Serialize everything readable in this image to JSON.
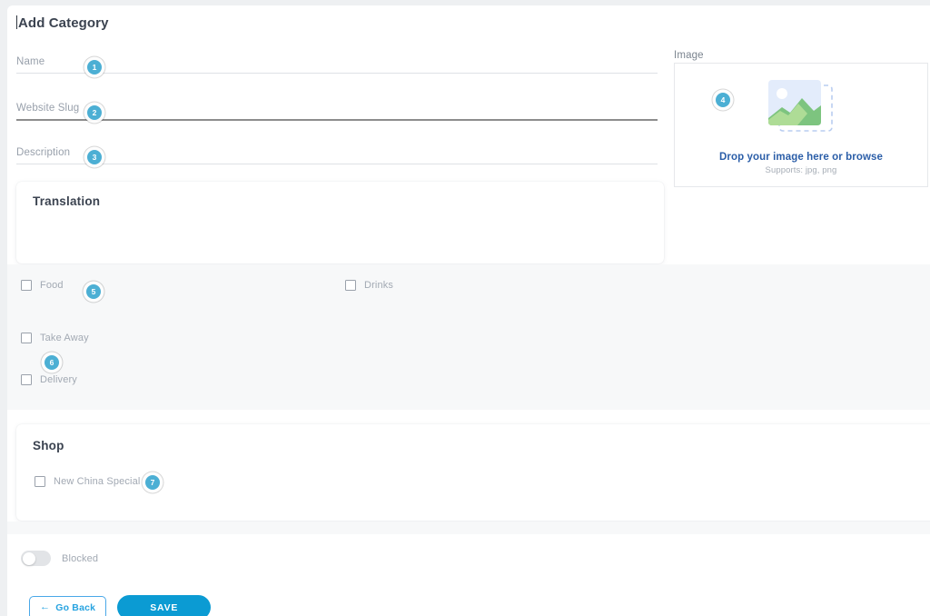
{
  "page": {
    "title": "Add Category"
  },
  "fields": [
    {
      "label": "Name",
      "value": "",
      "placeholder": "Name",
      "focused": false,
      "badge": "1"
    },
    {
      "label": "Website Slug",
      "value": "",
      "placeholder": "Website Slug",
      "focused": true,
      "badge": "2"
    },
    {
      "label": "Description",
      "value": "",
      "placeholder": "Description",
      "focused": false,
      "badge": "3"
    }
  ],
  "translation": {
    "title": "Translation"
  },
  "image": {
    "label": "Image",
    "badge": "4",
    "drop_text": "Drop your image here or browse",
    "supports": "Supports: jpg, png",
    "icon": "image-placeholder-icon"
  },
  "checkboxes": [
    {
      "label": "Food",
      "checked": false,
      "badge": "5"
    },
    {
      "label": "Drinks",
      "checked": false,
      "badge": ""
    },
    {
      "label": "Take Away",
      "checked": false,
      "badge": ""
    },
    {
      "label": "Delivery",
      "checked": false,
      "badge": "6"
    }
  ],
  "shop": {
    "title": "Shop",
    "items": [
      {
        "label": "New China Special",
        "checked": false,
        "badge": "7"
      }
    ]
  },
  "blocked": {
    "label": "Blocked",
    "enabled": false
  },
  "footer": {
    "back_label": "Go Back",
    "back_icon": "arrow-left-icon",
    "save_label": "SAVE"
  },
  "colors": {
    "accent": "#0b9bd3",
    "badge": "#4cafd4",
    "link": "#2b5ea8",
    "muted_text": "#a2a9b3",
    "surface": "#ffffff",
    "page_bg": "#eef0f2"
  }
}
